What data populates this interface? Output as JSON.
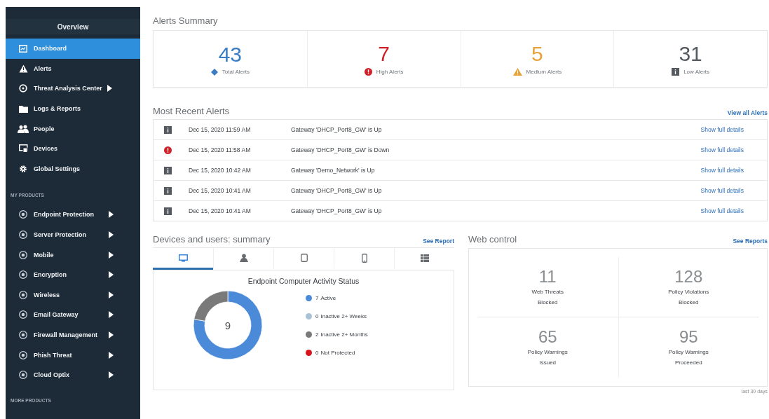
{
  "sidebar": {
    "header": "Overview",
    "items": [
      {
        "label": "Dashboard",
        "selected": true,
        "has_submenu": false
      },
      {
        "label": "Alerts",
        "selected": false,
        "has_submenu": false
      },
      {
        "label": "Threat Analysis Center",
        "selected": false,
        "has_submenu": true
      },
      {
        "label": "Logs & Reports",
        "selected": false,
        "has_submenu": false
      },
      {
        "label": "People",
        "selected": false,
        "has_submenu": false
      },
      {
        "label": "Devices",
        "selected": false,
        "has_submenu": false
      },
      {
        "label": "Global Settings",
        "selected": false,
        "has_submenu": false
      }
    ],
    "products_heading": "MY PRODUCTS",
    "products": [
      {
        "label": "Endpoint Protection",
        "selected": false,
        "has_submenu": true
      },
      {
        "label": "Server Protection",
        "selected": false,
        "has_submenu": true
      },
      {
        "label": "Mobile",
        "selected": false,
        "has_submenu": true
      },
      {
        "label": "Encryption",
        "selected": false,
        "has_submenu": true
      },
      {
        "label": "Wireless",
        "selected": false,
        "has_submenu": true
      },
      {
        "label": "Email Gateway",
        "selected": false,
        "has_submenu": true
      },
      {
        "label": "Firewall Management",
        "selected": false,
        "has_submenu": true
      },
      {
        "label": "Phish Threat",
        "selected": false,
        "has_submenu": true
      },
      {
        "label": "Cloud Optix",
        "selected": false,
        "has_submenu": true
      }
    ],
    "more_heading": "MORE PRODUCTS"
  },
  "alerts_summary": {
    "title": "Alerts Summary",
    "cards": [
      {
        "kind": "total",
        "value": "43",
        "label": "Total Alerts",
        "color": "#3a7cc4"
      },
      {
        "kind": "high",
        "value": "7",
        "label": "High Alerts",
        "color": "#d0202a"
      },
      {
        "kind": "medium",
        "value": "5",
        "label": "Medium Alerts",
        "color": "#e8a23a"
      },
      {
        "kind": "low",
        "value": "31",
        "label": "Low Alerts",
        "color": "#555a60"
      }
    ]
  },
  "recent_alerts": {
    "title": "Most Recent Alerts",
    "link": "View all Alerts",
    "rows": [
      {
        "kind": "info",
        "time": "Dec 15, 2020 11:59 AM",
        "message": "Gateway 'DHCP_Port8_GW' is Up",
        "link": "Show full details"
      },
      {
        "kind": "high",
        "time": "Dec 15, 2020 11:58 AM",
        "message": "Gateway 'DHCP_Port8_GW' is Down",
        "link": "Show full details"
      },
      {
        "kind": "info",
        "time": "Dec 15, 2020 10:42 AM",
        "message": "Gateway 'Demo_Network' is Up",
        "link": "Show full details"
      },
      {
        "kind": "info",
        "time": "Dec 15, 2020 10:41 AM",
        "message": "Gateway 'DHCP_Port8_GW' is Up",
        "link": "Show full details"
      },
      {
        "kind": "info",
        "time": "Dec 15, 2020 10:41 AM",
        "message": "Gateway 'DHCP_Port8_GW' is Up",
        "link": "Show full details"
      }
    ]
  },
  "devices_summary": {
    "title": "Devices and users: summary",
    "link": "See Report",
    "tabs": [
      {
        "selected": true
      },
      {
        "selected": false
      },
      {
        "selected": false
      },
      {
        "selected": false
      },
      {
        "selected": false
      }
    ],
    "chart_title": "Endpoint Computer Activity Status",
    "total": "9",
    "legend": [
      {
        "count": "7",
        "color": "#4a8ad8"
      },
      {
        "count": "0",
        "color": "#a9c3d6"
      },
      {
        "count": "2",
        "color": "#7a7a7a"
      },
      {
        "count": "0",
        "color": "#d8141c"
      }
    ],
    "chart_data": {
      "type": "donut",
      "categories": [
        "Active",
        "Inactive 2+ Weeks",
        "Inactive 2+ Months",
        "Not Protected"
      ],
      "values": [
        7,
        0,
        2,
        0
      ]
    }
  },
  "web_control": {
    "title": "Web control",
    "link": "See Reports",
    "stats": [
      {
        "value": "11",
        "label": "Web Threats Blocked"
      },
      {
        "value": "128",
        "label": "Policy Violations Blocked"
      },
      {
        "value": "65",
        "label": "Policy Warnings Issued"
      },
      {
        "value": "95",
        "label": "Policy Warnings Proceeded"
      }
    ],
    "footnote": "last 30 days"
  }
}
